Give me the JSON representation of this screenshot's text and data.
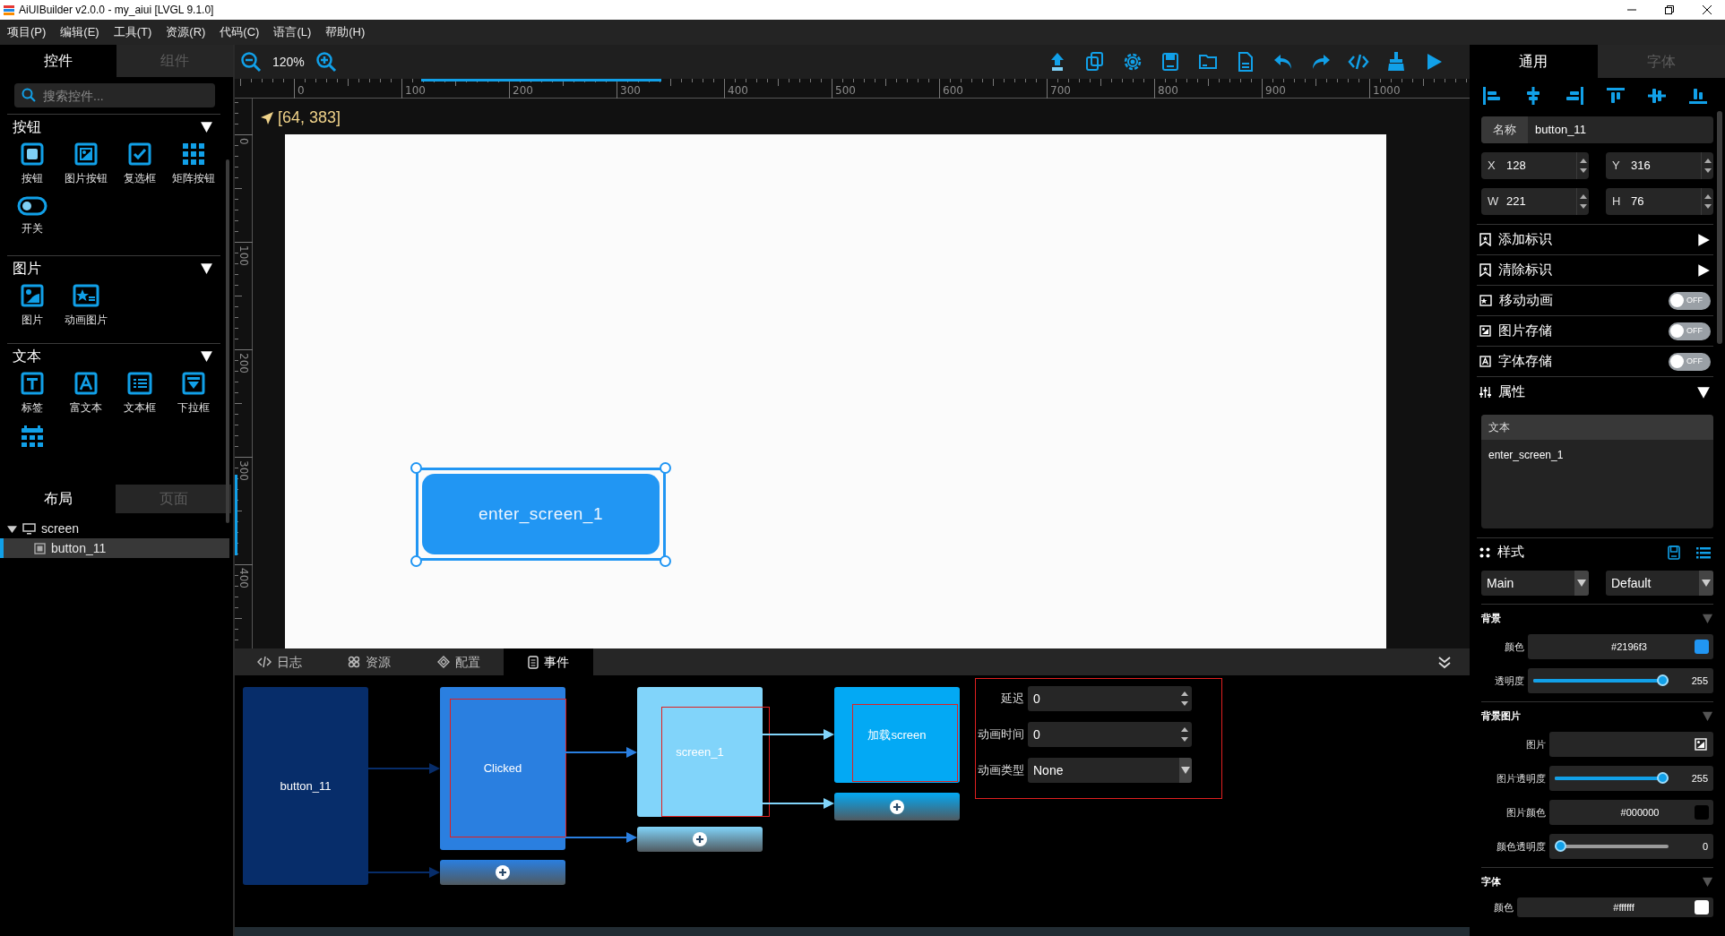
{
  "window": {
    "title": "AiUIBuilder v2.0.0 - my_aiui [LVGL 9.1.0]"
  },
  "menu": [
    "项目(P)",
    "编辑(E)",
    "工具(T)",
    "资源(R)",
    "代码(C)",
    "语言(L)",
    "帮助(H)"
  ],
  "left_tabs": [
    {
      "label": "控件",
      "selected": true
    },
    {
      "label": "组件",
      "selected": false
    }
  ],
  "search": {
    "placeholder": "搜索控件..."
  },
  "widget_groups": [
    {
      "title": "按钮",
      "expanded": true,
      "items": [
        {
          "kind": "button",
          "label": "按钮"
        },
        {
          "kind": "imagebutton",
          "label": "图片按钮"
        },
        {
          "kind": "checkbox",
          "label": "复选框"
        },
        {
          "kind": "matrix",
          "label": "矩阵按钮"
        },
        {
          "kind": "switch",
          "label": "开关"
        }
      ]
    },
    {
      "title": "图片",
      "expanded": true,
      "items": [
        {
          "kind": "image",
          "label": "图片"
        },
        {
          "kind": "animimage",
          "label": "动画图片"
        }
      ]
    },
    {
      "title": "文本",
      "expanded": true,
      "items": [
        {
          "kind": "label",
          "label": "标签"
        },
        {
          "kind": "richtext",
          "label": "富文本"
        },
        {
          "kind": "textarea",
          "label": "文本框"
        },
        {
          "kind": "dropdown",
          "label": "下拉框"
        },
        {
          "kind": "calendar"
        }
      ]
    }
  ],
  "layout_tabs": [
    {
      "label": "布局",
      "selected": true
    },
    {
      "label": "页面",
      "selected": false
    }
  ],
  "tree": [
    {
      "label": "screen",
      "expanded": true,
      "selected": false,
      "children": [
        {
          "label": "button_11",
          "selected": true
        }
      ]
    }
  ],
  "zoom": "120%",
  "rulers": {
    "x_labels": [
      "0",
      "100",
      "200",
      "300",
      "400",
      "500",
      "600",
      "700",
      "800",
      "900",
      "1000"
    ],
    "y_labels": [
      "0",
      "100",
      "200",
      "300",
      "400"
    ]
  },
  "cursor_position": "[64, 383]",
  "canvas_button": {
    "text": "enter_screen_1",
    "selected": true
  },
  "bottom_tabs": [
    {
      "label": "日志",
      "selected": false
    },
    {
      "label": "资源",
      "selected": false
    },
    {
      "label": "配置",
      "selected": false
    },
    {
      "label": "事件",
      "selected": true
    }
  ],
  "event_nodes": [
    {
      "label": "button_11",
      "color": "#072d6a",
      "highlighted": false,
      "add_button": false
    },
    {
      "label": "Clicked",
      "color": "#2a7fe0",
      "highlighted": true,
      "add_button": true
    },
    {
      "label": "screen_1",
      "color": "#81d4fa",
      "highlighted": true,
      "add_button": true
    },
    {
      "label": "加载screen",
      "color": "#03a9f4",
      "highlighted": true,
      "add_button": true
    }
  ],
  "event_settings": [
    {
      "kind": "spin",
      "label": "延迟",
      "value": "0"
    },
    {
      "kind": "spin",
      "label": "动画时间",
      "value": "0"
    },
    {
      "kind": "select",
      "label": "动画类型",
      "value": "None"
    }
  ],
  "right_tabs": [
    {
      "label": "通用",
      "selected": true
    },
    {
      "label": "字体",
      "selected": false
    }
  ],
  "name_field": {
    "label": "名称",
    "value": "button_11"
  },
  "geometry": [
    {
      "label": "X",
      "value": "128"
    },
    {
      "label": "Y",
      "value": "316"
    },
    {
      "label": "W",
      "value": "221"
    },
    {
      "label": "H",
      "value": "76"
    }
  ],
  "marks": [
    {
      "label": "添加标识"
    },
    {
      "label": "清除标识"
    }
  ],
  "toggles": [
    {
      "label": "移动动画",
      "on": false,
      "state_text": "OFF"
    },
    {
      "label": "图片存储",
      "on": false,
      "state_text": "OFF"
    },
    {
      "label": "字体存储",
      "on": false,
      "state_text": "OFF"
    }
  ],
  "attributes": {
    "title": "属性",
    "expanded": true,
    "text_label": "文本",
    "text_value": "enter_screen_1"
  },
  "style": {
    "title": "样式",
    "part": "Main",
    "state": "Default",
    "sections": [
      {
        "title": "背景",
        "expanded": true,
        "rows": [
          {
            "kind": "color",
            "label": "颜色",
            "value": "#2196f3",
            "color": "#2196f3"
          },
          {
            "kind": "slider",
            "label": "透明度",
            "level": 1,
            "reading": "255"
          }
        ]
      },
      {
        "title": "背景图片",
        "expanded": true,
        "rows": [
          {
            "kind": "image",
            "label": "图片"
          },
          {
            "kind": "slider",
            "label": "图片透明度",
            "level": 1,
            "reading": "255"
          },
          {
            "kind": "color",
            "label": "图片颜色",
            "value": "#000000",
            "color": "#000000"
          },
          {
            "kind": "slider",
            "label": "颜色透明度",
            "level": 0,
            "reading": "0"
          }
        ]
      },
      {
        "title": "字体",
        "expanded": true,
        "rows": [
          {
            "kind": "color",
            "label": "颜色",
            "value": "#ffffff",
            "color": "#ffffff"
          }
        ]
      }
    ]
  }
}
